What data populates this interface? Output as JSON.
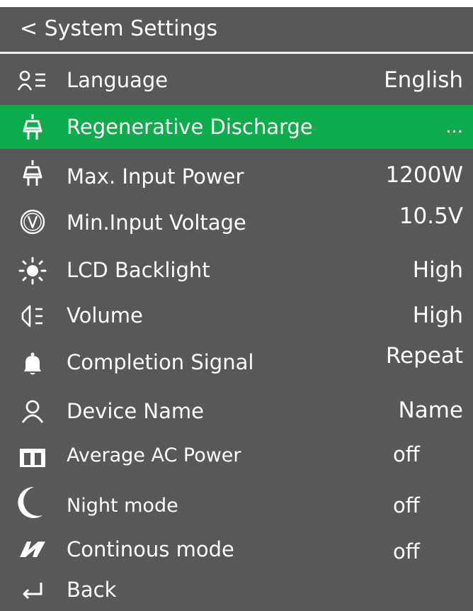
{
  "header": {
    "title": "< System Settings"
  },
  "menu": [
    {
      "label": "Language",
      "value": "English",
      "icon": "language-icon"
    },
    {
      "label": "Regenerative Discharge",
      "value": "...",
      "icon": "plug-icon",
      "selected": true
    },
    {
      "label": "Max. Input Power",
      "value": "1200W",
      "icon": "plug-icon"
    },
    {
      "label": "Min.Input Voltage",
      "value": "10.5V",
      "icon": "voltage-icon"
    },
    {
      "label": "LCD Backlight",
      "value": "High",
      "icon": "brightness-icon"
    },
    {
      "label": "Volume",
      "value": "High",
      "icon": "speaker-icon"
    },
    {
      "label": "Completion Signal",
      "value": "Repeat",
      "icon": "bell-icon"
    },
    {
      "label": "Device Name",
      "value": "Name",
      "icon": "user-icon"
    },
    {
      "label": "Average AC Power",
      "value": "off",
      "icon": "average-icon"
    },
    {
      "label": "Night mode",
      "value": "off",
      "icon": "moon-icon"
    },
    {
      "label": "Continous mode",
      "value": "off",
      "icon": "continuous-icon"
    },
    {
      "label": "Back",
      "icon": "return-icon"
    }
  ],
  "colors": {
    "background": "#585858",
    "selected": "#0eac4c",
    "text": "#ffffff"
  }
}
